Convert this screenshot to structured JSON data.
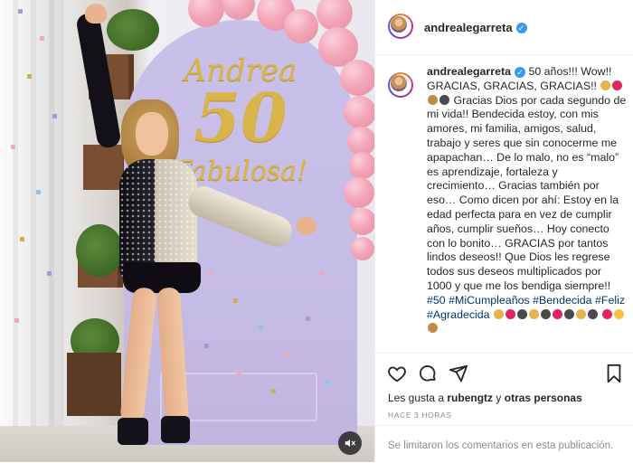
{
  "post": {
    "username": "andrealegarreta",
    "verified_icon": "verified-badge-icon",
    "caption_parts": [
      "50 años!!! Wow!! GRACIAS, GRACIAS, GRACIAS!!",
      "Gracias Dios por cada segundo de mi vida!! Bendecida estoy, con mis amores, mi familia, amigos, salud, trabajo y seres que sin conocerme me apapachan… De lo malo, no es “malo” es aprendizaje, fortaleza y crecimiento… Gracias también por eso… Como dicen por ahí: Estoy en la edad perfecta para en vez de cumplir años, cumplir sueños… Hoy conecto con lo bonito… GRACIAS por tantos lindos deseos!! Que Dios les regrese todos sus deseos multiplicados por 1000 y que me los bendiga siempre!!"
    ],
    "hashtags": [
      "#50",
      "#MiCumpleaños",
      "#Bendecida",
      "#Feliz",
      "#Agradecida"
    ],
    "likes_prefix": "Les gusta a",
    "likes_user": "rubengtz",
    "likes_joiner": "y",
    "likes_others": "otras personas",
    "time": "HACE 3 HORAS",
    "comments_disabled": "Se limitaron los comentarios en esta publicación."
  },
  "media": {
    "backdrop_name": "Andrea",
    "backdrop_number": "50",
    "backdrop_tagline": "Fabulosa!",
    "mute_icon": "muted-speaker-icon"
  },
  "colors": {
    "accent_blue": "#3897f0",
    "hashtag": "#00376b",
    "muted_text": "#8e8e8e",
    "backdrop": "#c9c1ea",
    "balloon": "#f3a7b9",
    "gold_text": "#d8b44a"
  },
  "icons": [
    "heart-icon",
    "comment-icon",
    "share-icon",
    "bookmark-icon"
  ]
}
